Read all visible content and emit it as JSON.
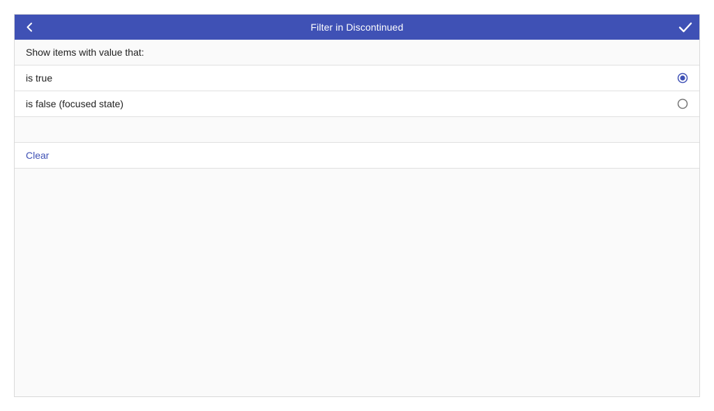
{
  "header": {
    "title": "Filter in Discontinued"
  },
  "prompt": "Show items with value that:",
  "options": [
    {
      "label": "is true",
      "selected": true
    },
    {
      "label": "is false (focused state)",
      "selected": false
    }
  ],
  "actions": {
    "clear_label": "Clear"
  },
  "colors": {
    "accent": "#3f51b5",
    "radio_unchecked": "#757575"
  },
  "icons": {
    "back": "chevron-left-icon",
    "confirm": "checkmark-icon"
  }
}
